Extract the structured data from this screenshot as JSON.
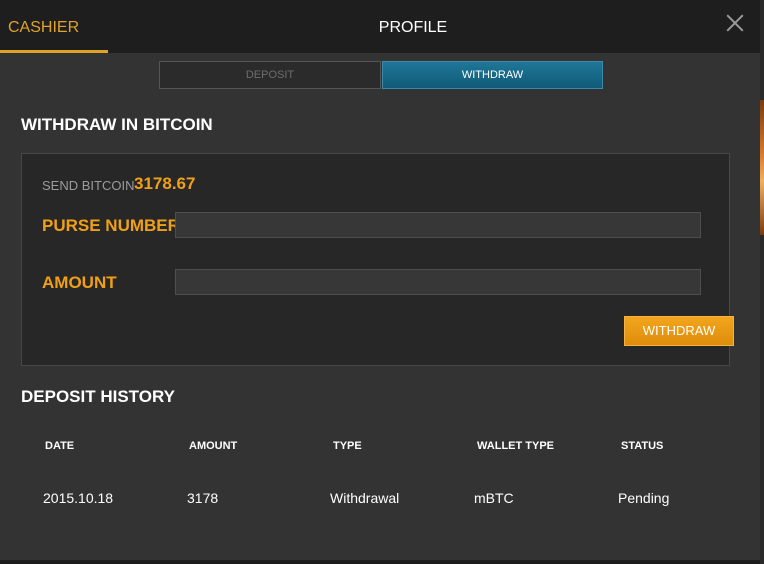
{
  "header": {
    "tabs": [
      {
        "label": "CASHIER",
        "active": true
      },
      {
        "label": "PROFILE",
        "active": false
      }
    ]
  },
  "mode_tabs": {
    "deposit": "DEPOSIT",
    "withdraw": "WITHDRAW",
    "active": "withdraw"
  },
  "withdraw_section": {
    "title": "WITHDRAW IN BITCOIN",
    "send_label": "SEND BITCOIN",
    "send_amount": "3178.67",
    "purse_label": "PURSE NUMBER",
    "purse_value": "",
    "amount_label": "AMOUNT",
    "amount_value": "",
    "submit_label": "WITHDRAW"
  },
  "history": {
    "title": "DEPOSIT HISTORY",
    "columns": [
      "DATE",
      "AMOUNT",
      "TYPE",
      "WALLET TYPE",
      "STATUS"
    ],
    "rows": [
      [
        "2015.10.18",
        "3178",
        "Withdrawal",
        "mBTC",
        "Pending"
      ]
    ]
  },
  "colors": {
    "accent_orange": "#f0a016",
    "tab_active_blue": "#1f7797",
    "background": "#333333"
  },
  "icons": {
    "close": "close-icon"
  }
}
